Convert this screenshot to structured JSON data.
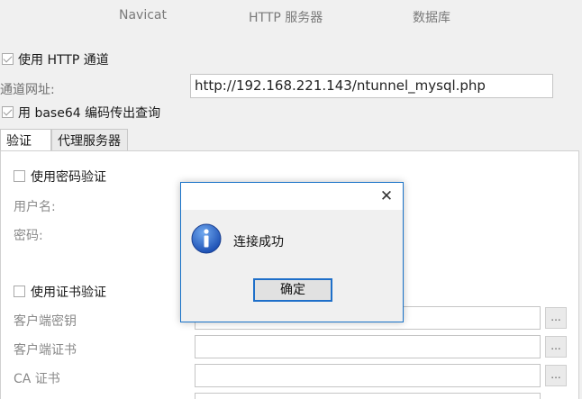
{
  "top_tabs": [
    "Navicat",
    "HTTP 服务器",
    "数据库"
  ],
  "http": {
    "use_http_tunnel_label": "使用 HTTP 通道",
    "tunnel_url_label": "通道网址:",
    "tunnel_url_value": "http://192.168.221.143/ntunnel_mysql.php",
    "base64_label": "用 base64 编码传出查询"
  },
  "sub_tabs": {
    "auth": "验证",
    "proxy": "代理服务器"
  },
  "auth_panel": {
    "use_password_auth": "使用密码验证",
    "username_label": "用户名:",
    "password_label": "密码:",
    "use_cert_auth": "使用证书验证",
    "client_key_label": "客户端密钥",
    "client_cert_label": "客户端证书",
    "ca_cert_label": "CA 证书",
    "browse_label": "..."
  },
  "dialog": {
    "close_glyph": "✕",
    "message": "连接成功",
    "ok_label": "确定",
    "icon": "info-icon"
  },
  "colors": {
    "dialog_border": "#1a73c8",
    "info_icon": "#1c63c6"
  }
}
